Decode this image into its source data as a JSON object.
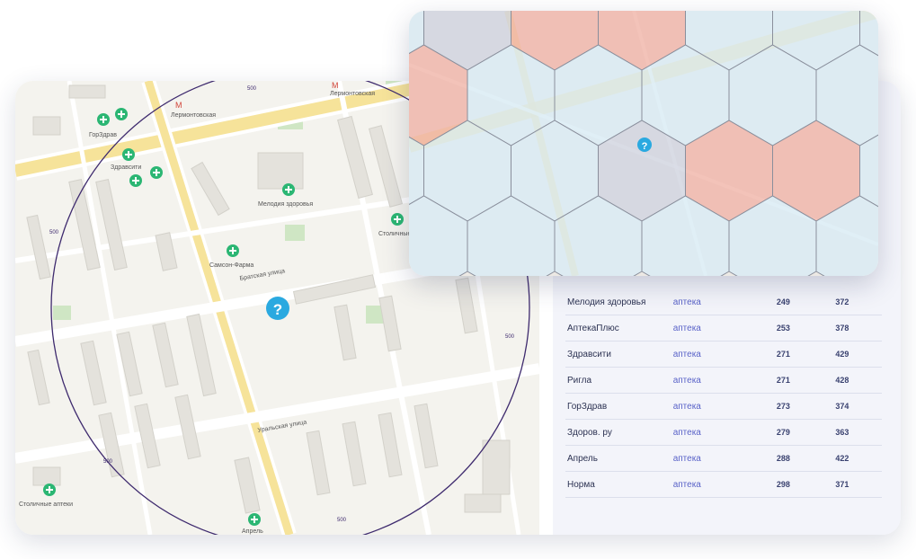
{
  "map": {
    "streets": [
      "Братская улица",
      "Уральская улица"
    ],
    "pharmacies": [
      {
        "name": "ГорЗдрав"
      },
      {
        "name": "Здравсити"
      },
      {
        "name": "Мелодия здоровья"
      },
      {
        "name": "Самсон-Фарма"
      },
      {
        "name": "Столичные"
      },
      {
        "name": "Столичные аптеки"
      },
      {
        "name": "Апрель"
      }
    ],
    "metro": [
      "Лермонтовская",
      "Лермонтовская"
    ],
    "radius_labels": [
      "500",
      "500",
      "500",
      "500",
      "500"
    ],
    "poi_icon": "plus-icon",
    "target_icon": "question-icon",
    "colors": {
      "pharmacy": "#2bb673",
      "target": "#2aa9e0",
      "circle": "#3e2a6e"
    }
  },
  "hex_map": {
    "target_icon": "question-icon",
    "colors": {
      "hot": "#f1b3a8",
      "cold": "#d8ecf6",
      "mid": "#cfd4e0"
    }
  },
  "table": {
    "rows": [
      {
        "name": "Мелодия здоровья",
        "type": "аптека",
        "v1": "249",
        "v2": "372"
      },
      {
        "name": "АптекаПлюс",
        "type": "аптека",
        "v1": "253",
        "v2": "378"
      },
      {
        "name": "Здравсити",
        "type": "аптека",
        "v1": "271",
        "v2": "429"
      },
      {
        "name": "Ригла",
        "type": "аптека",
        "v1": "271",
        "v2": "428"
      },
      {
        "name": "ГорЗдрав",
        "type": "аптека",
        "v1": "273",
        "v2": "374"
      },
      {
        "name": "Здоров. ру",
        "type": "аптека",
        "v1": "279",
        "v2": "363"
      },
      {
        "name": "Апрель",
        "type": "аптека",
        "v1": "288",
        "v2": "422"
      },
      {
        "name": "Норма",
        "type": "аптека",
        "v1": "298",
        "v2": "371"
      }
    ]
  }
}
